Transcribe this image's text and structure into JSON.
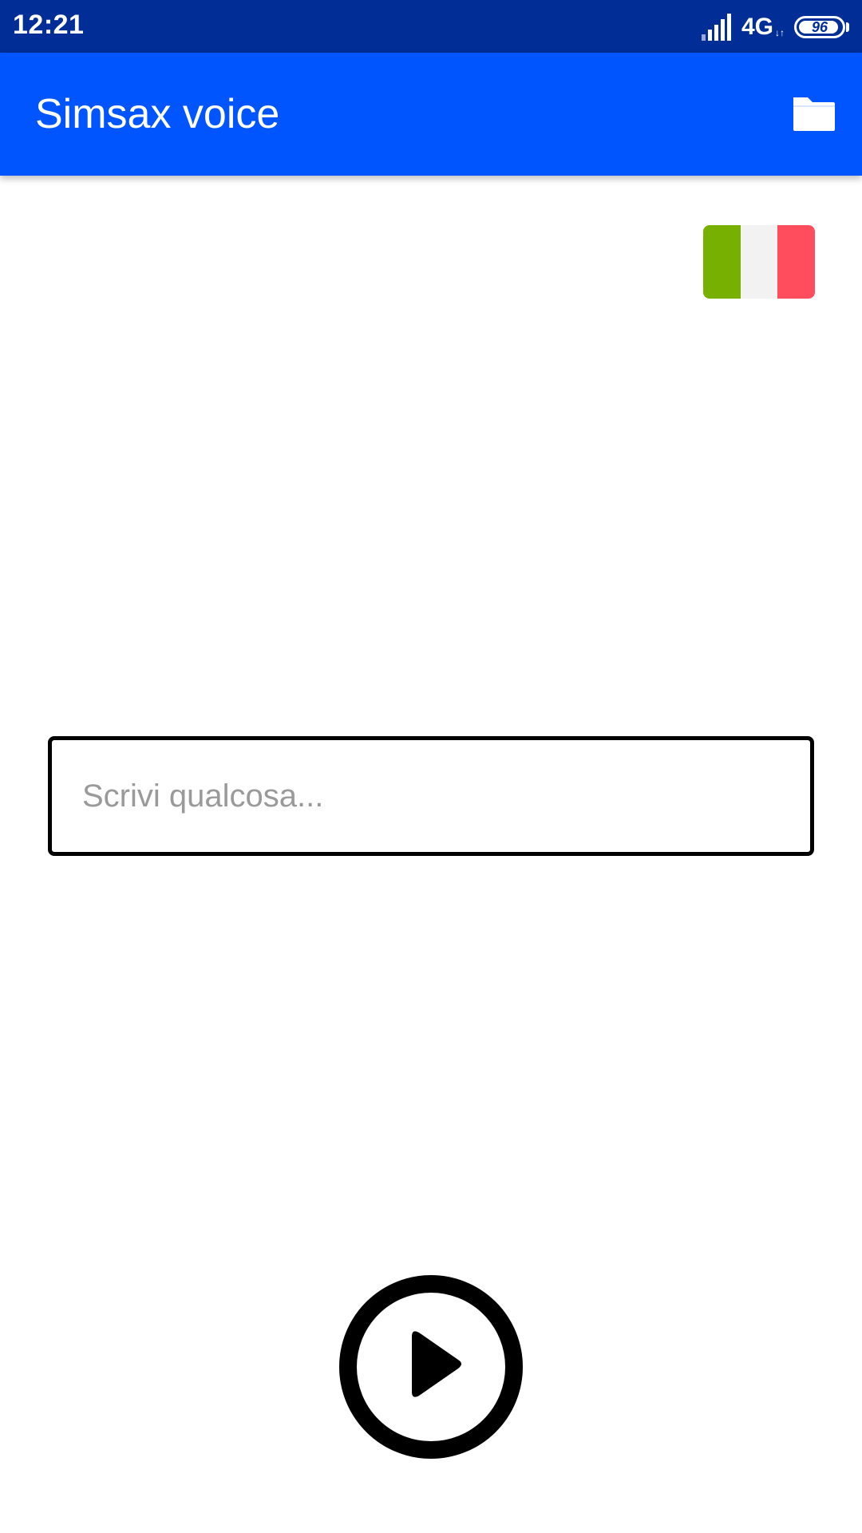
{
  "status_bar": {
    "time": "12:21",
    "network": "4G",
    "network_arrows": "↓↑",
    "battery_level": "96",
    "battery_percent": 96,
    "signal_icon": "signal-bars-icon",
    "battery_icon": "battery-icon"
  },
  "app_bar": {
    "title": "Simsax voice",
    "folder_icon": "folder-icon"
  },
  "language": {
    "flag_icon": "italy-flag-icon",
    "colors": [
      "#78b000",
      "#f2f2f2",
      "#ff4d5e"
    ]
  },
  "input": {
    "placeholder": "Scrivi qualcosa...",
    "value": ""
  },
  "play": {
    "icon": "play-circle-icon"
  },
  "colors": {
    "status_bar": "#002e96",
    "app_bar": "#0055ff",
    "background": "#ffffff"
  }
}
